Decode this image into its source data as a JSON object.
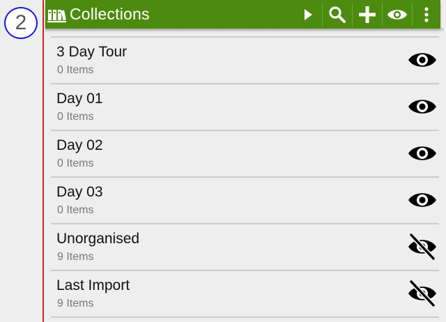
{
  "step_badge": "2",
  "toolbar": {
    "title": "Collections",
    "icons": {
      "app": "books-icon",
      "play": "play-icon",
      "search": "search-icon",
      "add": "plus-icon",
      "visibility": "eye-icon",
      "more": "more-vert-icon"
    },
    "background_color": "#4c8b0f"
  },
  "collections": [
    {
      "name": "3 Day Tour",
      "count": "0 Items",
      "visible": true
    },
    {
      "name": "Day 01",
      "count": "0 Items",
      "visible": true
    },
    {
      "name": "Day 02",
      "count": "0 Items",
      "visible": true
    },
    {
      "name": "Day 03",
      "count": "0 Items",
      "visible": true
    },
    {
      "name": "Unorganised",
      "count": "9 Items",
      "visible": false
    },
    {
      "name": "Last Import",
      "count": "9 Items",
      "visible": false
    }
  ]
}
